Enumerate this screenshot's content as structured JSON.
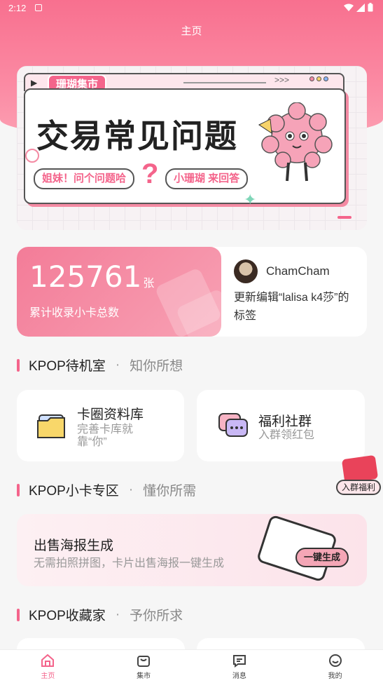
{
  "status_bar": {
    "time": "2:12"
  },
  "header": {
    "title": "主页"
  },
  "banner": {
    "tag": "珊瑚集市",
    "arrows": ">>>",
    "headline": "交易常见问题",
    "bubble_left": "姐妹！问个问题哈",
    "bubble_right": "小珊瑚 来回答"
  },
  "stats": {
    "total_cards": "125761",
    "unit": "张",
    "label": "累计收录小卡总数",
    "user_name": "ChamCham",
    "update_text": "更新编辑“lalisa k4莎”的标签"
  },
  "section1": {
    "title": "KPOP待机室",
    "subtitle": "知你所想"
  },
  "card_library": {
    "title": "卡圈资料库",
    "desc": "完善卡库就靠“你”"
  },
  "card_community": {
    "title": "福利社群",
    "desc": "入群领红包"
  },
  "floating_badge": {
    "label": "入群福利"
  },
  "section2": {
    "title": "KPOP小卡专区",
    "subtitle": "懂你所需"
  },
  "poster": {
    "title": "出售海报生成",
    "desc": "无需拍照拼图，卡片出售海报一键生成",
    "button": "一键生成"
  },
  "section3": {
    "title": "KPOP收藏家",
    "subtitle": "予你所求"
  },
  "tabs": [
    {
      "label": "主页",
      "icon": "home-icon",
      "active": true
    },
    {
      "label": "集市",
      "icon": "bag-icon",
      "active": false
    },
    {
      "label": "消息",
      "icon": "message-icon",
      "active": false
    },
    {
      "label": "我的",
      "icon": "profile-icon",
      "active": false
    }
  ],
  "colors": {
    "accent": "#f4648b",
    "header_bg": "#f8708f"
  }
}
